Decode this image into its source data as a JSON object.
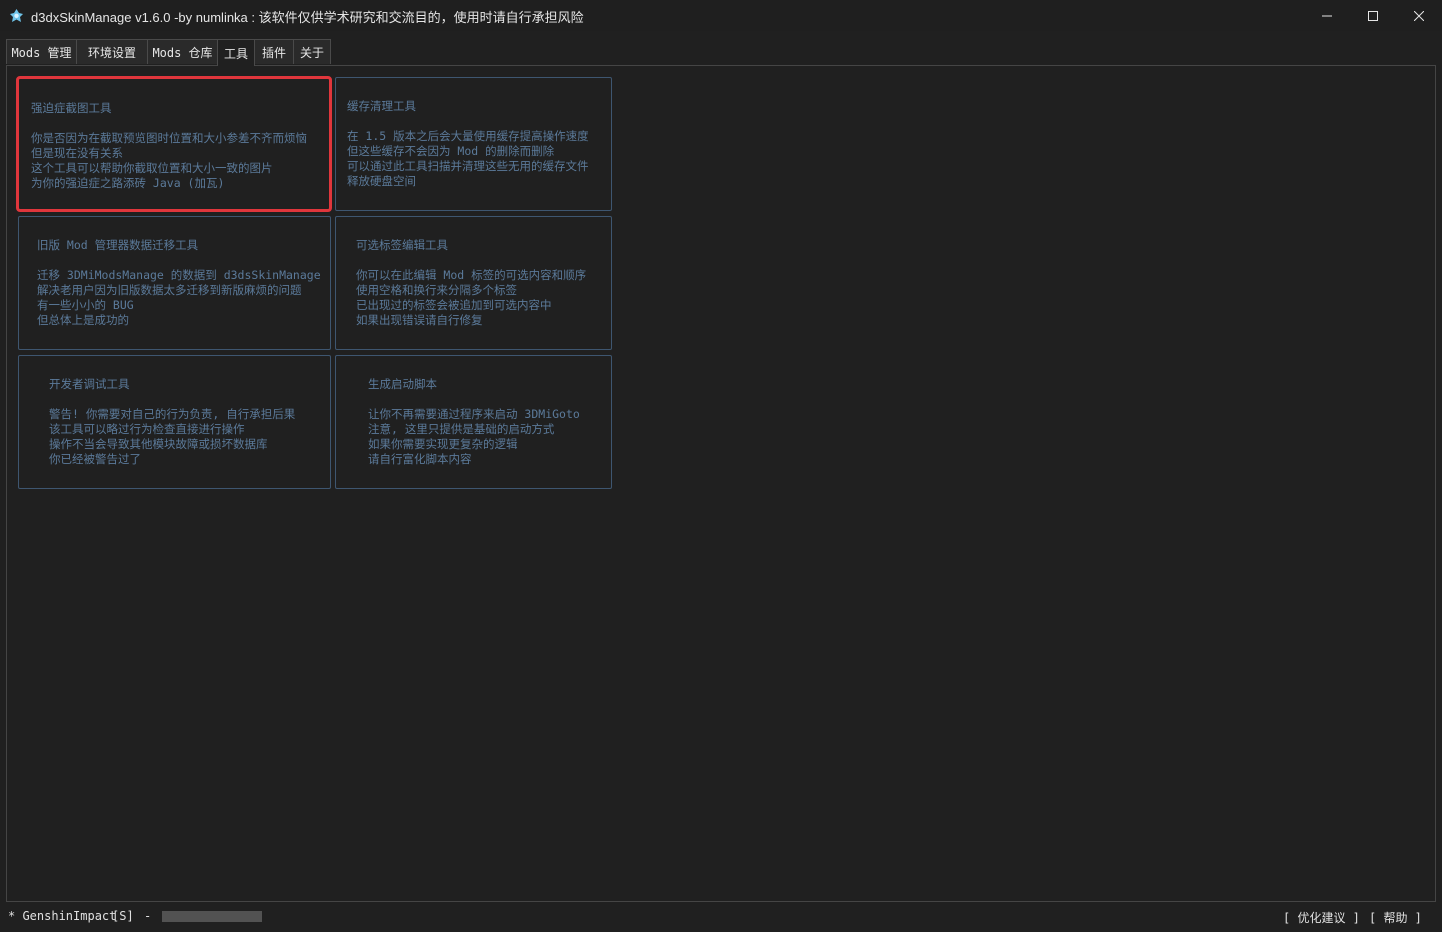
{
  "window": {
    "title": "d3dxSkinManage v1.6.0 -by numlinka : 该软件仅供学术研究和交流目的，使用时请自行承担风险"
  },
  "tabs": [
    {
      "label": "Mods 管理",
      "active": false
    },
    {
      "label": "环境设置",
      "active": false
    },
    {
      "label": "Mods 仓库",
      "active": false
    },
    {
      "label": "工具",
      "active": true
    },
    {
      "label": "插件",
      "active": false
    },
    {
      "label": "关于",
      "active": false
    }
  ],
  "tools": [
    {
      "title": "强迫症截图工具",
      "lines": [
        "你是否因为在截取预览图时位置和大小参差不齐而烦恼",
        "但是现在没有关系",
        "这个工具可以帮助你截取位置和大小一致的图片",
        "为你的强迫症之路添砖 Java (加瓦)"
      ],
      "selected": true
    },
    {
      "title": "缓存清理工具",
      "lines": [
        "在 1.5 版本之后会大量使用缓存提高操作速度",
        "但这些缓存不会因为 Mod 的删除而删除",
        "可以通过此工具扫描并清理这些无用的缓存文件",
        "释放硬盘空间"
      ],
      "selected": false
    },
    {
      "title": "旧版 Mod 管理器数据迁移工具",
      "lines": [
        "迁移 3DMiModsManage 的数据到 d3dsSkinManage",
        "解决老用户因为旧版数据太多迁移到新版麻烦的问题",
        "有一些小小的 BUG",
        "但总体上是成功的"
      ],
      "selected": false
    },
    {
      "title": "可选标签编辑工具",
      "lines": [
        "你可以在此编辑 Mod 标签的可选内容和顺序",
        "使用空格和换行来分隔多个标签",
        "已出现过的标签会被追加到可选内容中",
        "如果出现错误请自行修复"
      ],
      "selected": false
    },
    {
      "title": "开发者调试工具",
      "lines": [
        "警告! 你需要对自己的行为负责, 自行承担后果",
        "该工具可以略过行为检查直接进行操作",
        "操作不当会导致其他模块故障或损坏数据库",
        "你已经被警告过了"
      ],
      "selected": false
    },
    {
      "title": "生成启动脚本",
      "lines": [
        "让你不再需要通过程序来启动 3DMiGoto",
        "注意, 这里只提供是基础的启动方式",
        "如果你需要实现更复杂的逻辑",
        "请自行富化脚本内容"
      ],
      "selected": false
    }
  ],
  "status": {
    "game": "* GenshinImpact",
    "mode": "[S]",
    "separator": "-",
    "progress": 0,
    "suggest_link": "[ 优化建议 ]",
    "help_link": "[ 帮助 ]"
  },
  "colors": {
    "background": "#202020",
    "card_border": "#3e5670",
    "card_text": "#5b7a9a",
    "selected_border": "#e0363c",
    "text": "#e6e6e6"
  },
  "icons": {
    "app": "app-logo-icon",
    "minimize": "minimize-icon",
    "maximize": "maximize-icon",
    "close": "close-icon"
  }
}
